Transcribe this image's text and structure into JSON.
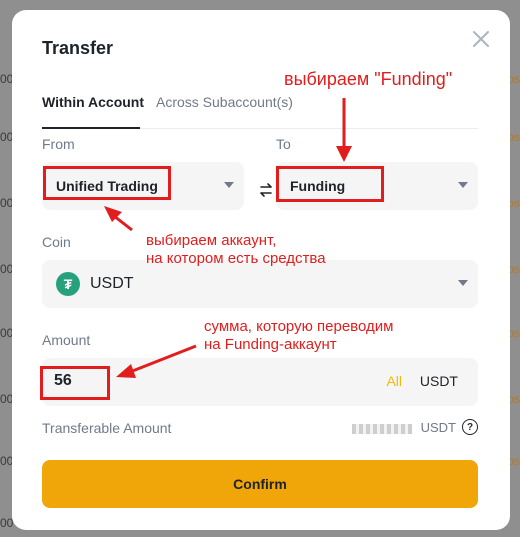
{
  "modal": {
    "title": "Transfer",
    "tabs": [
      "Within Account",
      "Across Subaccount(s)"
    ],
    "from_label": "From",
    "to_label": "To",
    "from_value": "Unified Trading",
    "to_value": "Funding",
    "coin_label": "Coin",
    "coin_value": "USDT",
    "coin_icon_glyph": "₮",
    "amount_label": "Amount",
    "amount_value": "56",
    "all_label": "All",
    "amount_unit": "USDT",
    "transferable_label": "Transferable Amount",
    "transferable_unit": "USDT",
    "help_glyph": "?",
    "confirm_label": "Confirm"
  },
  "annotations": {
    "to_hint": "выбираем \"Funding\"",
    "from_hint_line1": "выбираем аккаунт,",
    "from_hint_line2": "на котором есть средства",
    "amount_hint_line1": "сумма, которую переводим",
    "amount_hint_line2": "на Funding-аккаунт"
  },
  "colors": {
    "accent": "#f0a608",
    "annotation": "#e21d1d",
    "tether": "#26a17b"
  },
  "icons": [
    "close-icon",
    "swap-icon",
    "tether-icon",
    "help-icon",
    "caret-down-icon"
  ]
}
